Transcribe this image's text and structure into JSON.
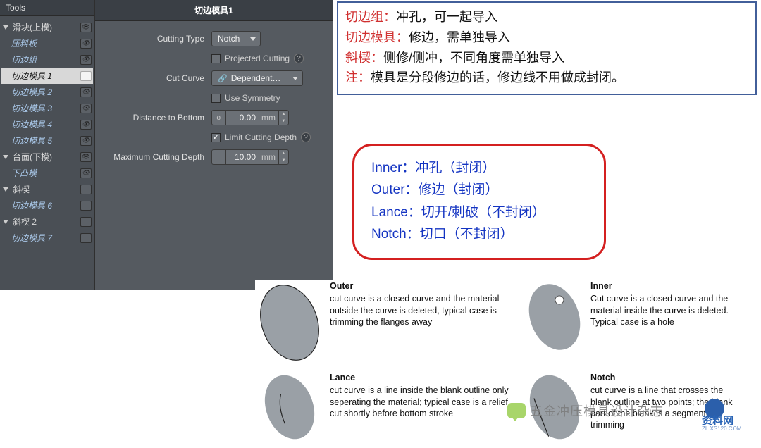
{
  "panel": {
    "tools_header": "Tools",
    "tree": {
      "root1": "滑块(上模)",
      "child1a": "压料板",
      "child1b": "切边组",
      "child1c_selected": "切边模具 1",
      "child1d": "切边模具 2",
      "child1e": "切边模具 3",
      "child1f": "切边模具 4",
      "child1g": "切边模具 5",
      "root2": "台面(下模)",
      "child2a": "下凸模",
      "root3": "斜楔",
      "child3a": "切边模具 6",
      "root4": "斜楔 2",
      "child4a": "切边模具 7"
    },
    "props": {
      "title": "切边模具1",
      "cutting_type_label": "Cutting Type",
      "cutting_type_value": "Notch",
      "projected_cutting_label": "Projected Cutting",
      "cut_curve_label": "Cut Curve",
      "cut_curve_value": "Dependent…",
      "use_symmetry_label": "Use Symmetry",
      "distance_bottom_label": "Distance to Bottom",
      "distance_bottom_value": "0.00",
      "distance_bottom_unit": "mm",
      "limit_depth_label": "Limit Cutting Depth",
      "max_depth_label": "Maximum Cutting Depth",
      "max_depth_value": "10.00",
      "max_depth_unit": "mm"
    }
  },
  "top_notes": [
    {
      "k": "切边组：",
      "v": "冲孔，可一起导入"
    },
    {
      "k": "切边模具：",
      "v": "修边，需单独导入"
    },
    {
      "k": "斜楔：",
      "v": "侧修/侧冲，不同角度需单独导入"
    },
    {
      "k": "注：",
      "v": "模具是分段修边的话，修边线不用做成封闭。"
    }
  ],
  "red_box": [
    {
      "k": "Inner：",
      "v": "冲孔（封闭）"
    },
    {
      "k": "Outer：",
      "v": "修边（封闭）"
    },
    {
      "k": "Lance：",
      "v": "切开/刺破（不封闭）"
    },
    {
      "k": "Notch：",
      "v": "切口（不封闭）"
    }
  ],
  "illus": {
    "outer": {
      "title": "Outer",
      "desc": "cut curve is a closed curve and the material outside the curve is deleted, typical case is trimming the flanges away"
    },
    "inner": {
      "title": "Inner",
      "desc": "Cut curve is a closed curve and the material inside the curve is deleted. Typical case is a hole"
    },
    "lance": {
      "title": "Lance",
      "desc": "cut curve is a line inside the blank outline only seperating the material; typical case is a relief cut shortly before bottom stroke"
    },
    "notch": {
      "title": "Notch",
      "desc": "cut curve is a line that crosses the blank outline at two points; the blank part of the blank is a segmented trimming"
    }
  },
  "watermarks": {
    "wm_text": "五金冲压模具设计杂志",
    "logo2_txt": "资料网",
    "logo2_sub": "ZL.XS120.COM"
  }
}
